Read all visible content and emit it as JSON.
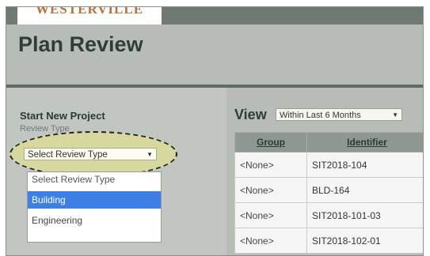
{
  "logo": {
    "text": "WESTERVILLE"
  },
  "header": {
    "title": "Plan Review"
  },
  "left_panel": {
    "heading": "Start New Project",
    "review_type_label": "Review Type",
    "review_select": {
      "value": "Select Review Type",
      "options": [
        "Select Review Type",
        "Building",
        "Engineering"
      ],
      "highlighted_index": 1
    }
  },
  "right_panel": {
    "view_label": "View",
    "view_select_value": "Within Last 6 Months",
    "table": {
      "columns": [
        "Group",
        "Identifier"
      ],
      "rows": [
        [
          "<None>",
          "SIT2018-104"
        ],
        [
          "<None>",
          "BLD-164"
        ],
        [
          "<None>",
          "SIT2018-101-03"
        ],
        [
          "<None>",
          "SIT2018-102-01"
        ]
      ]
    }
  },
  "colors": {
    "header_bg": "#b8bcb6",
    "dark_rule": "#5f6c64",
    "highlight_option": "#3d7fe4",
    "logo": "#b5733f"
  }
}
